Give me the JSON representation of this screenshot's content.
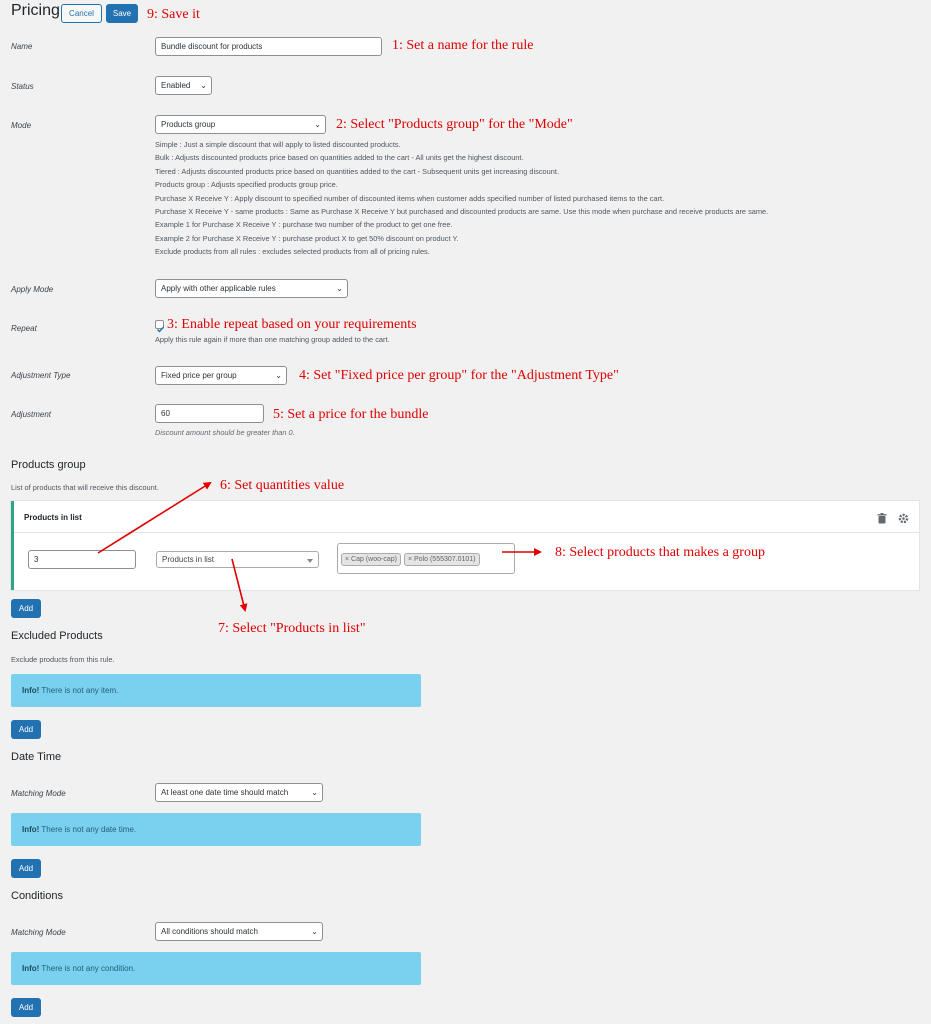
{
  "header": {
    "title": "Pricing",
    "cancel_label": "Cancel",
    "save_label": "Save"
  },
  "annotations": {
    "a1": "1: Set a name for the rule",
    "a2": "2: Select \"Products group\" for the \"Mode\"",
    "a3": "3: Enable repeat based on your requirements",
    "a4": "4: Set \"Fixed price per group\" for the \"Adjustment Type\"",
    "a5": "5: Set a price for the bundle",
    "a6": "6: Set quantities value",
    "a7": "7: Select \"Products in list\"",
    "a8": "8: Select products that makes a group",
    "a9": "9: Save it"
  },
  "form": {
    "name_label": "Name",
    "name_value": "Bundle discount for products",
    "status_label": "Status",
    "status_value": "Enabled",
    "mode_label": "Mode",
    "mode_value": "Products group",
    "mode_descriptions": [
      "Simple : Just a simple discount that will apply to listed discounted products.",
      "Bulk : Adjusts discounted products price based on quantities added to the cart - All units get the highest discount.",
      "Tiered : Adjusts discounted products price based on quantities added to the cart - Subsequent units get increasing discount.",
      "Products group : Adjusts specified products group price.",
      "Purchase X Receive Y : Apply discount to specified number of discounted items when customer adds specified number of listed purchased items to the cart.",
      "Purchase X Receive Y - same products : Same as Purchase X Receive Y but purchased and discounted products are same. Use this mode when purchase and receive products are same.",
      "Example 1 for Purchase X Receive Y : purchase two number of the product to get one free.",
      "Example 2 for Purchase X Receive Y : purchase product X to get 50% discount on product Y.",
      "Exclude products from all rules : excludes selected products from all of pricing rules."
    ],
    "apply_mode_label": "Apply Mode",
    "apply_mode_value": "Apply with other applicable rules",
    "repeat_label": "Repeat",
    "repeat_desc": "Apply this rule again if more than one matching group added to the cart.",
    "adjustment_type_label": "Adjustment Type",
    "adjustment_type_value": "Fixed price per group",
    "adjustment_label": "Adjustment",
    "adjustment_value": "60",
    "adjustment_desc": "Discount amount should be greater than 0."
  },
  "products_group": {
    "title": "Products group",
    "desc": "List of products that will receive this discount.",
    "panel_title": "Products in list",
    "quantity": "3",
    "type_value": "Products in list",
    "products": [
      "Cap (woo-cap)",
      "Polo (555307.0101)"
    ],
    "add_label": "Add"
  },
  "excluded": {
    "title": "Excluded Products",
    "desc": "Exclude products from this rule.",
    "info_strong": "Info!",
    "info_text": "There is not any item.",
    "add_label": "Add"
  },
  "datetime": {
    "title": "Date Time",
    "matching_label": "Matching Mode",
    "matching_value": "At least one date time should match",
    "info_strong": "Info!",
    "info_text": "There is not any date time.",
    "add_label": "Add"
  },
  "conditions": {
    "title": "Conditions",
    "matching_label": "Matching Mode",
    "matching_value": "All conditions should match",
    "info_strong": "Info!",
    "info_text": "There is not any condition.",
    "add_label": "Add"
  },
  "colors": {
    "primary": "#2271b1",
    "annotation": "#e00000",
    "info": "#7ad0ef",
    "panel_accent": "#2fa582"
  }
}
